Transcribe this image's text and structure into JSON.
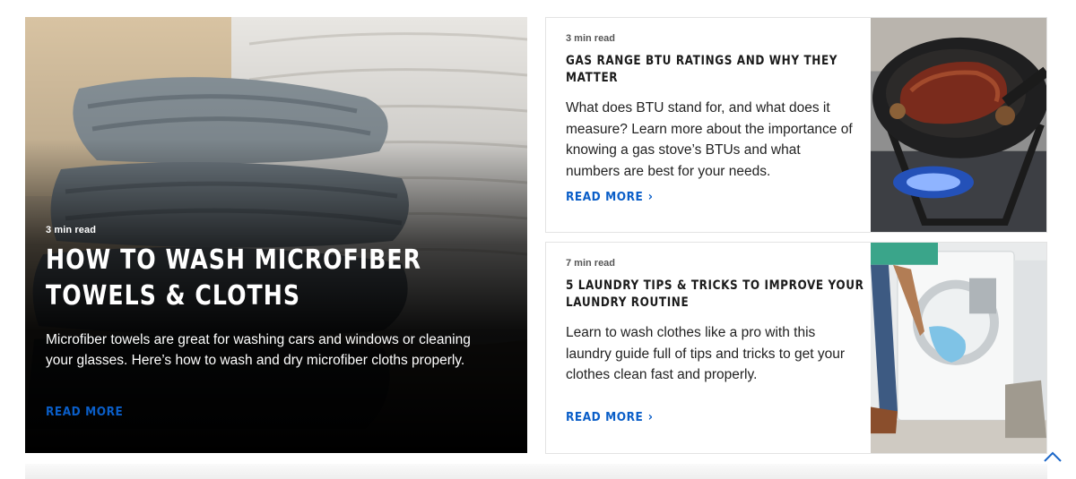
{
  "feature": {
    "read_time": "3 min read",
    "title": "HOW TO WASH MICROFIBER TOWELS & CLOTHS",
    "description": "Microfiber towels are great for washing cars and windows or cleaning your glasses. Here’s how to wash and dry microfiber cloths properly.",
    "read_more": "READ MORE",
    "image_icon": "folded-microfiber-towels-photo"
  },
  "articles": [
    {
      "read_time": "3 min read",
      "title": "GAS RANGE BTU RATINGS AND WHY THEY MATTER",
      "description": "What does BTU stand for, and what does it measure? Learn more about the importance of knowing a gas stove’s BTUs and what numbers are best for your needs.",
      "read_more": "READ MORE",
      "image_icon": "steak-in-skillet-on-gas-burner-photo"
    },
    {
      "read_time": "7 min read",
      "title": "5 LAUNDRY TIPS & TRICKS TO IMPROVE YOUR LAUNDRY ROUTINE",
      "description": "Learn to wash clothes like a pro with this laundry guide full of tips and tricks to get your clothes clean fast and properly.",
      "read_more": "READ MORE",
      "image_icon": "person-loading-washer-photo"
    }
  ],
  "colors": {
    "link": "#0a5ec8",
    "card_border": "#e3e3e3",
    "feature_bg": "#000000"
  },
  "scroll_top_icon": "chevron-up-icon"
}
